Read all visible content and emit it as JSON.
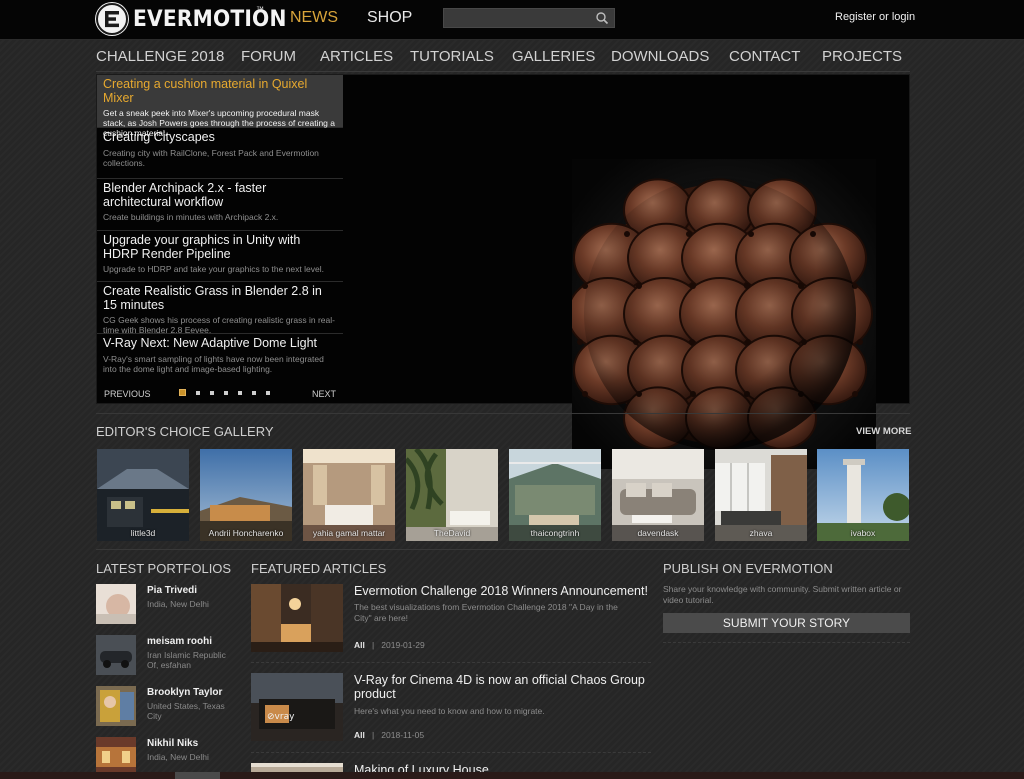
{
  "brand": {
    "name": "EVERMOTION",
    "tm": "™"
  },
  "topnav": {
    "news": "NEWS",
    "shop": "SHOP",
    "register": "Register or login",
    "search_placeholder": ""
  },
  "mainnav": [
    "CHALLENGE 2018",
    "FORUM",
    "ARTICLES",
    "TUTORIALS",
    "GALLERIES",
    "DOWNLOADS",
    "CONTACT",
    "PROJECTS"
  ],
  "slider": {
    "items": [
      {
        "title": "Creating a cushion material in Quixel Mixer",
        "desc": "Get a sneak peek into Mixer's upcoming procedural mask stack, as Josh Powers goes through the process of creating a cushion material."
      },
      {
        "title": "Creating Cityscapes",
        "desc": "Creating city with RailClone, Forest Pack and Evermotion collections."
      },
      {
        "title": "Blender Archipack 2.x - faster architectural workflow",
        "desc": "Create buildings in minutes with Archipack 2.x."
      },
      {
        "title": "Upgrade your graphics in Unity with HDRP Render Pipeline",
        "desc": "Upgrade to HDRP and take your graphics to the next level."
      },
      {
        "title": "Create Realistic Grass in Blender 2.8 in 15 minutes",
        "desc": "CG Geek shows his process of creating realistic grass in real-time with Blender 2.8 Eevee."
      },
      {
        "title": "V-Ray Next: New Adaptive Dome Light",
        "desc": "V-Ray's smart sampling of lights have now been integrated into the dome light and image-based lighting."
      }
    ],
    "prev": "PREVIOUS",
    "next": "NEXT",
    "active_index": 0
  },
  "gallery": {
    "title": "EDITOR'S CHOICE GALLERY",
    "view_more": "VIEW MORE",
    "thumbs": [
      "little3d",
      "Andrii Honcharenko",
      "yahia gamal mattar",
      "TheDavid",
      "thaicongtrinh",
      "davendask",
      "zhava",
      "ivabox"
    ]
  },
  "portfolios": {
    "title": "LATEST PORTFOLIOS",
    "items": [
      {
        "name": "Pia Trivedi",
        "location": "India, New Delhi"
      },
      {
        "name": "meisam roohi",
        "location": "Iran Islamic Republic Of, esfahan"
      },
      {
        "name": "Brooklyn Taylor",
        "location": "United States, Texas City"
      },
      {
        "name": "Nikhil Niks",
        "location": "India, New Delhi"
      }
    ]
  },
  "featured": {
    "title": "FEATURED ARTICLES",
    "items": [
      {
        "title": "Evermotion Challenge 2018 Winners Announcement!",
        "desc": "The best visualizations from Evermotion Challenge 2018 \"A Day in the City\" are here!",
        "tag": "All",
        "sep": "|",
        "date": "2019-01-29"
      },
      {
        "title": "V-Ray for Cinema 4D is now an official Chaos Group product",
        "desc": "Here's what you need to know and how to migrate.",
        "tag": "All",
        "sep": "|",
        "date": "2018-11-05"
      },
      {
        "title": "Making of Luxury House",
        "desc": "",
        "tag": "",
        "sep": "",
        "date": ""
      }
    ]
  },
  "publish": {
    "title": "PUBLISH ON EVERMOTION",
    "desc": "Share your knowledge with community. Submit written article or video tutorial.",
    "button": "SUBMIT YOUR STORY"
  },
  "colors": {
    "accent": "#e7a92f",
    "bg": "#262626",
    "topbar": "#050505"
  }
}
